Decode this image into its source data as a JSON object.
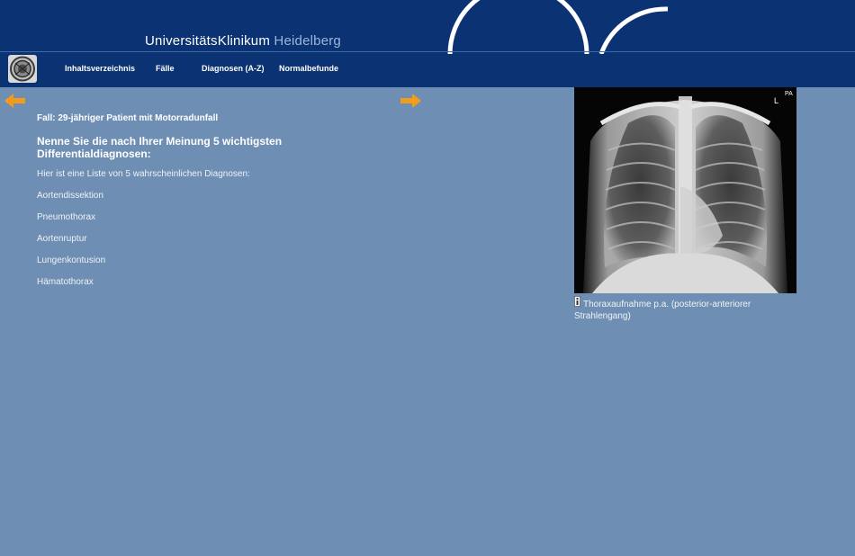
{
  "header": {
    "brand_part1": "UniversitätsKlinikum",
    "brand_part2": "Heidelberg"
  },
  "nav": {
    "items": [
      {
        "label": "Inhaltsverzeichnis"
      },
      {
        "label": "Fälle"
      },
      {
        "label": "Diagnosen (A-Z)"
      },
      {
        "label": "Normalbefunde"
      }
    ]
  },
  "arrows": {
    "prev_icon": "arrow-left-icon",
    "next_icon": "arrow-right-icon",
    "color": "#f39c1c"
  },
  "main": {
    "case_title": "Fall: 29-jähriger Patient mit Motorradunfall",
    "question": "Nenne Sie die nach Ihrer Meinung 5 wichtigsten Differentialdiagnosen:",
    "intro": "Hier ist eine Liste von 5 wahrscheinlichen Diagnosen:",
    "diagnoses": [
      "Aortendissektion",
      "Pneumothorax",
      "Aortenruptur",
      "Lungenkontusion",
      "Hämatothorax"
    ]
  },
  "image": {
    "marker_l": "L",
    "marker_pa": "PA",
    "caption": "Thoraxaufnahme p.a. (posterior-anteriorer Strahlengang)",
    "caption_icon": "info-icon"
  },
  "colors": {
    "header_bg": "#0b3273",
    "page_bg": "#6e8fb3",
    "accent_arrow": "#f39c1c"
  }
}
